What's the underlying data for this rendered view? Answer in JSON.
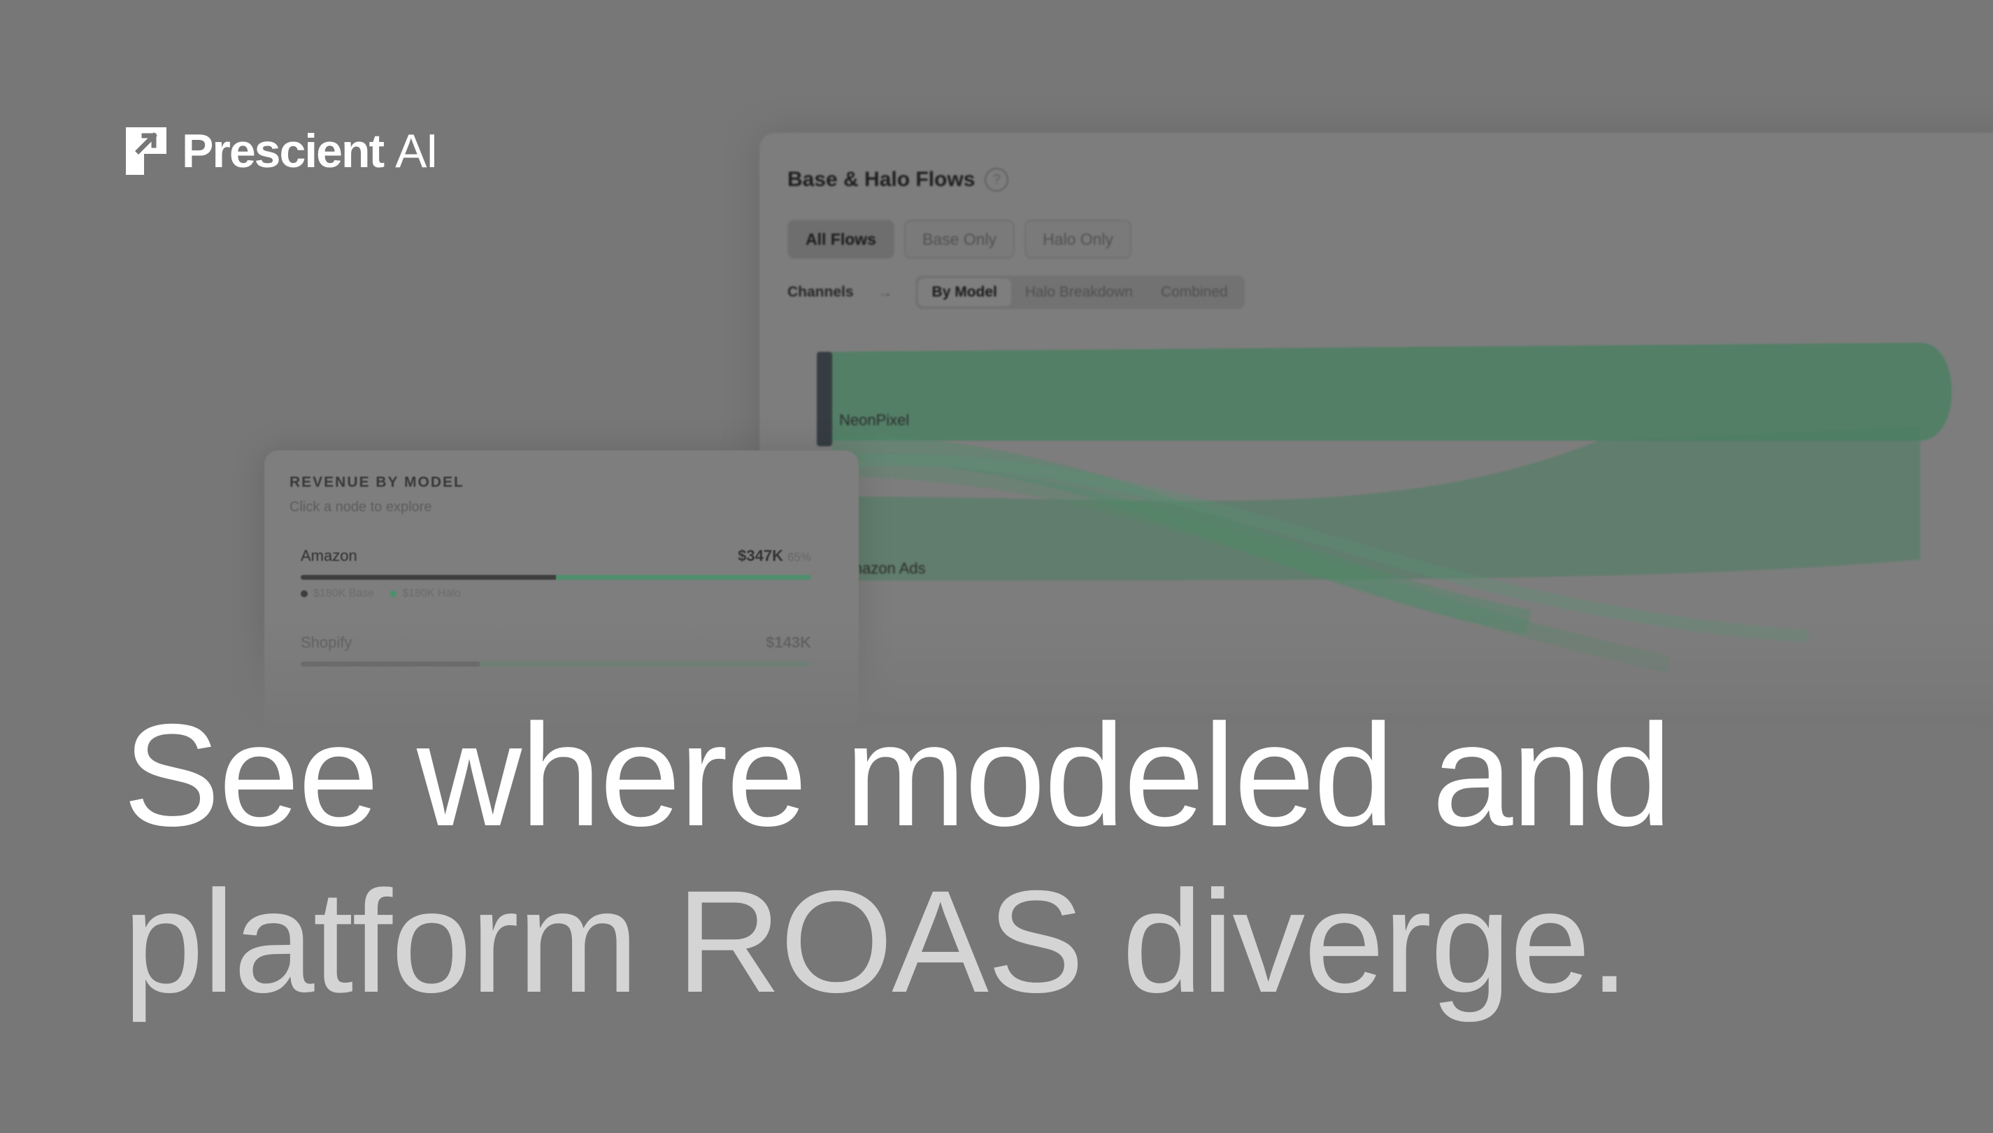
{
  "brand": {
    "name": "Prescient",
    "suffix": "AI"
  },
  "flows_card": {
    "title": "Base & Halo Flows",
    "help": "?",
    "tabs": [
      {
        "label": "All Flows",
        "active": true
      },
      {
        "label": "Base Only",
        "active": false
      },
      {
        "label": "Halo Only",
        "active": false
      }
    ],
    "channels_label": "Channels",
    "arrow": "→",
    "views": [
      {
        "label": "By Model",
        "active": true
      },
      {
        "label": "Halo Breakdown",
        "active": false
      },
      {
        "label": "Combined",
        "active": false
      }
    ],
    "nodes": [
      "NeonPixel",
      "Amazon Ads"
    ]
  },
  "revenue_card": {
    "title": "REVENUE BY MODEL",
    "subtitle": "Click a node to explore",
    "rows": [
      {
        "name": "Amazon",
        "amount": "$347K",
        "pct": "65%",
        "base_share": 0.5,
        "base_label": "$180K Base",
        "halo_label": "$180K Halo"
      },
      {
        "name": "Shopify",
        "amount": "$143K",
        "pct": "",
        "base_share": 0.35,
        "base_label": "",
        "halo_label": ""
      }
    ]
  },
  "headline": {
    "line1": "See where modeled and",
    "line2": "platform ROAS diverge."
  },
  "colors": {
    "background": "#777777",
    "halo_green": "#4e8f6d",
    "headline": "#ffffff",
    "headline_secondary": "#d4d4d4"
  }
}
